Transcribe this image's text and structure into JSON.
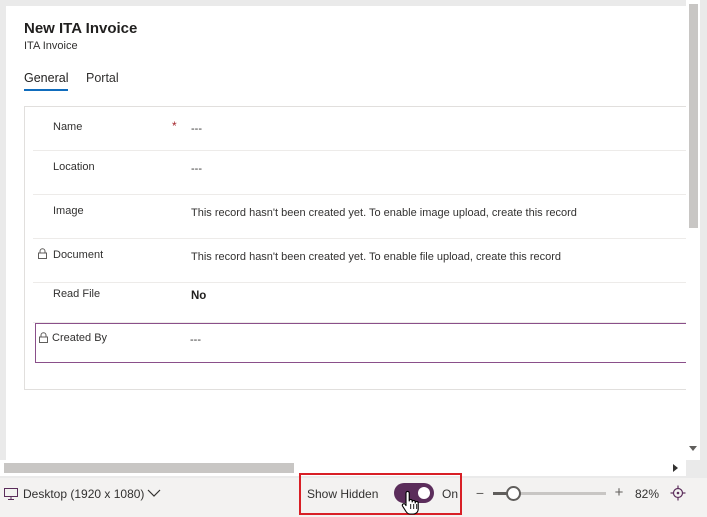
{
  "form": {
    "title": "New ITA Invoice",
    "subtitle": "ITA Invoice",
    "tabs": [
      {
        "label": "General",
        "active": true
      },
      {
        "label": "Portal",
        "active": false
      }
    ],
    "fields": [
      {
        "label": "Name",
        "value": "---",
        "required": true,
        "locked": false
      },
      {
        "label": "Location",
        "value": "---",
        "required": false,
        "locked": false
      },
      {
        "label": "Image",
        "value": "This record hasn't been created yet. To enable image upload, create this record",
        "required": false,
        "locked": false
      },
      {
        "label": "Document",
        "value": "This record hasn't been created yet. To enable file upload, create this record",
        "required": false,
        "locked": true
      },
      {
        "label": "Read File",
        "value": "No",
        "required": false,
        "locked": false
      },
      {
        "label": "Created By",
        "value": "---",
        "required": false,
        "locked": true,
        "selected": true
      }
    ],
    "required_marker": "*"
  },
  "toolbar": {
    "device_icon": "monitor-icon",
    "device_label": "Desktop (1920 x 1080)",
    "show_hidden_label": "Show Hidden",
    "show_hidden_state": "On",
    "show_hidden_on": true,
    "zoom_minus": "−",
    "zoom_plus": "+",
    "zoom_value": "82%",
    "zoom_level": 0.82,
    "fit_icon": "fit-to-screen-icon"
  },
  "colors": {
    "accent_tab": "#0f6cbd",
    "toggle_on": "#5b2d5b",
    "highlight_box": "#d81f26",
    "selected_row_border": "#8a4f8a",
    "required": "#a4262c"
  }
}
